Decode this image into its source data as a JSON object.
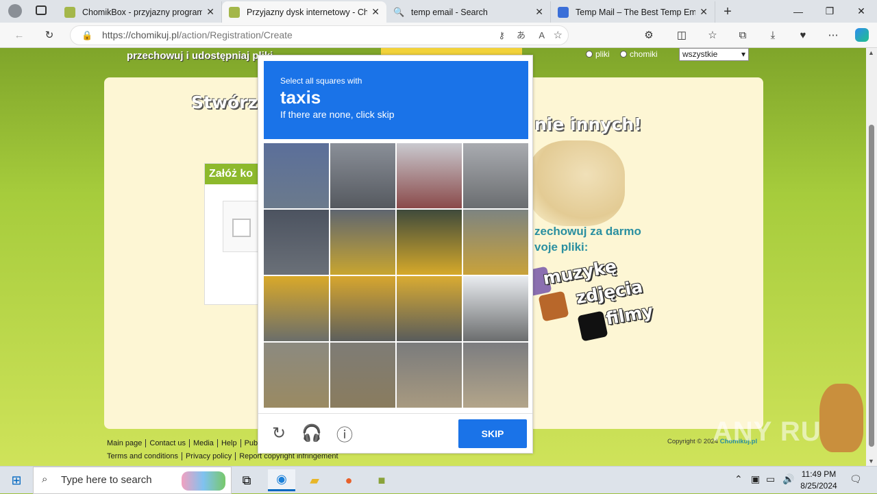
{
  "browser": {
    "tabs": [
      {
        "title": "ChomikBox - przyjazny program",
        "active": false
      },
      {
        "title": "Przyjazny dysk internetowy - Cho",
        "active": true
      },
      {
        "title": "temp email - Search",
        "active": false
      },
      {
        "title": "Temp Mail – The Best Temp Email",
        "active": false
      }
    ],
    "url_host": "https://chomikuj.pl",
    "url_path": "/action/Registration/Create"
  },
  "site": {
    "top_text": "przechowuj i udostępniaj pliki",
    "radio_files": "pliki",
    "radio_users": "chomiki",
    "search_scope": "wszystkie",
    "headline_left": "Stwórz",
    "headline_right": "nie innych!",
    "register_header": "Załóż ko",
    "promo_line1": "zechowuj za darmo",
    "promo_line2": "voje pliki:",
    "promo_music": "muzykę",
    "promo_photos": "zdjęcia",
    "promo_films": "filmy",
    "footer_row1": [
      "Main page",
      "Contact us",
      "Media",
      "Help",
      "Publ"
    ],
    "footer_row2": [
      "Terms and conditions",
      "Privacy policy",
      "Report copyright infringement"
    ],
    "copyright": "Copyright © 2024",
    "copyright_brand": "Chomikuj.pl",
    "watermark": "ANY RUN"
  },
  "captcha": {
    "instruction": "Select all squares with",
    "target": "taxis",
    "hint": "If there are none, click skip",
    "skip_label": "SKIP",
    "accent": "#1a73e8"
  },
  "taskbar": {
    "search_placeholder": "Type here to search",
    "time": "11:49 PM",
    "date": "8/25/2024"
  }
}
